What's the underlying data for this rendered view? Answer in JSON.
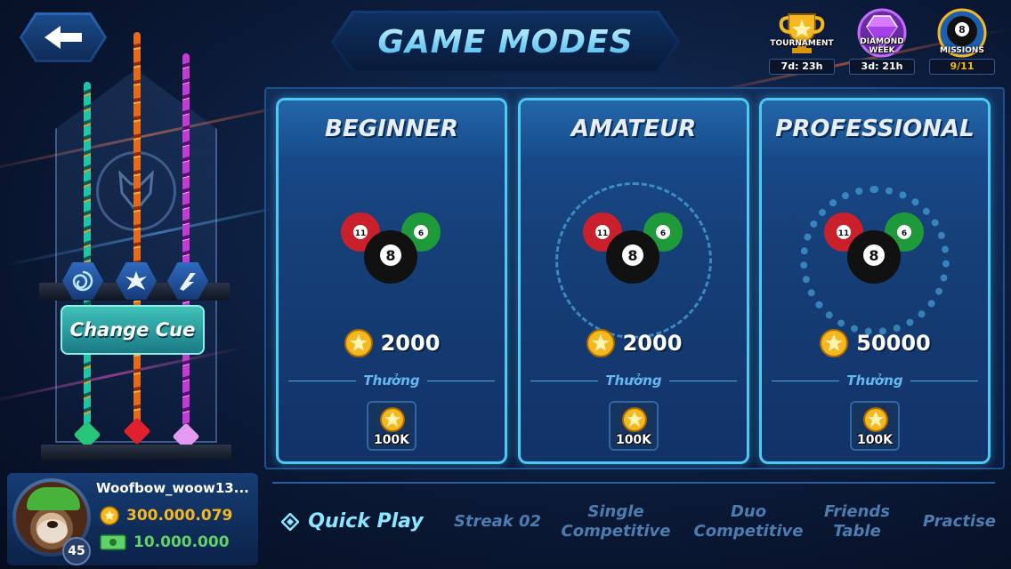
{
  "title": "GAME MODES",
  "events": [
    {
      "label": "TOURNAMENT",
      "timer": "7d: 23h",
      "icon": "trophy-icon"
    },
    {
      "label": "DIAMOND WEEK",
      "timer": "3d: 21h",
      "icon": "diamond-icon"
    },
    {
      "label": "MISSIONS",
      "timer": "9/11",
      "icon": "eight-ball-icon"
    }
  ],
  "cue_rack": {
    "change_cue_label": "Change Cue"
  },
  "player": {
    "name": "Woofbow_woow13...",
    "level": "45",
    "coins": "300.000.079",
    "cash": "10.000.000"
  },
  "modes": [
    {
      "name": "BEGINNER",
      "entry_fee": "2000",
      "reward_label": "Thưởng",
      "reward_amount": "100K"
    },
    {
      "name": "AMATEUR",
      "entry_fee": "2000",
      "reward_label": "Thưởng",
      "reward_amount": "100K"
    },
    {
      "name": "PROFESSIONAL",
      "entry_fee": "50000",
      "reward_label": "Thưởng",
      "reward_amount": "100K"
    }
  ],
  "tabs": {
    "quick_play": "Quick Play",
    "streak": "Streak 02",
    "single_line1": "Single",
    "single_line2": "Competitive",
    "duo_line1": "Duo",
    "duo_line2": "Competitive",
    "friends_line1": "Friends",
    "friends_line2": "Table",
    "practise": "Practise"
  },
  "colors": {
    "accent": "#4cc9f4",
    "gold": "#f5b820",
    "cash_green": "#5fd36a",
    "active_tab": "#8be7ff"
  }
}
